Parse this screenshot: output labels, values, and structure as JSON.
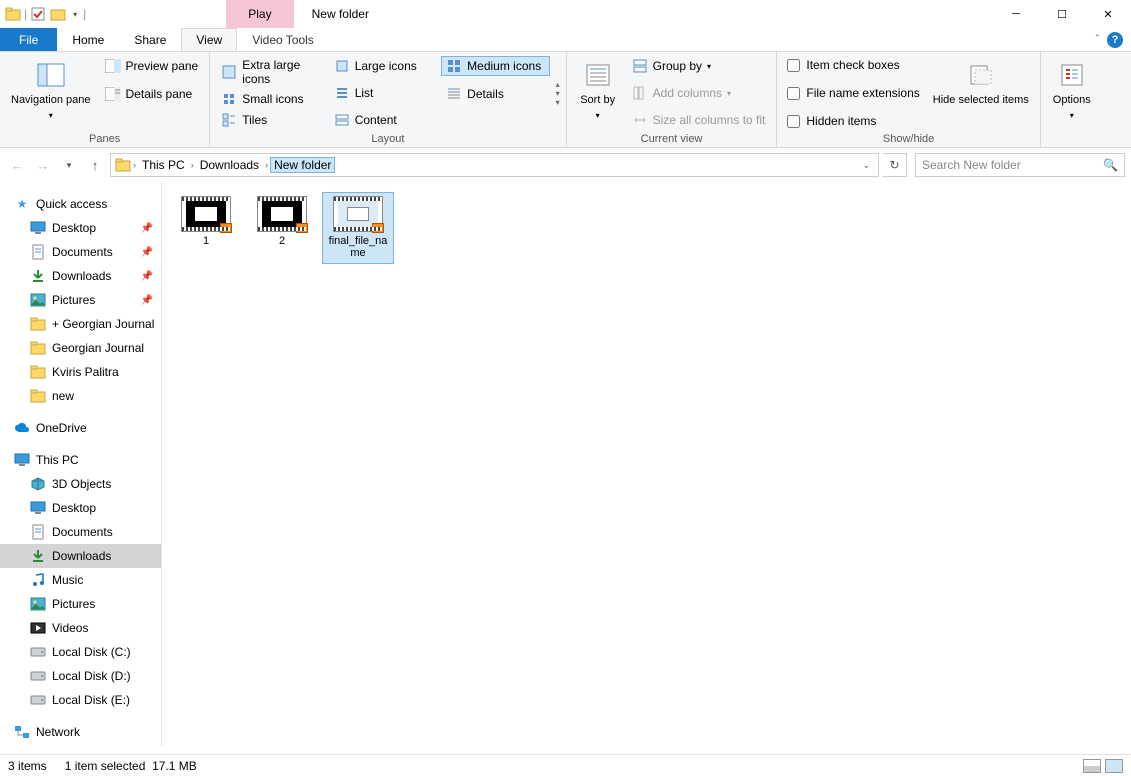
{
  "titlebar": {
    "context_tab": "Play",
    "title": "New folder"
  },
  "tabs": {
    "file": "File",
    "home": "Home",
    "share": "Share",
    "view": "View",
    "video_tools": "Video Tools"
  },
  "ribbon": {
    "panes": {
      "nav": "Navigation pane",
      "preview": "Preview pane",
      "details": "Details pane",
      "group_label": "Panes"
    },
    "layout": {
      "xl": "Extra large icons",
      "large": "Large icons",
      "medium": "Medium icons",
      "small": "Small icons",
      "list": "List",
      "details": "Details",
      "tiles": "Tiles",
      "content": "Content",
      "group_label": "Layout"
    },
    "current_view": {
      "sort": "Sort by",
      "group": "Group by",
      "add_cols": "Add columns",
      "size_cols": "Size all columns to fit",
      "group_label": "Current view"
    },
    "show_hide": {
      "item_check": "Item check boxes",
      "ext": "File name extensions",
      "hidden": "Hidden items",
      "hide_sel": "Hide selected items",
      "group_label": "Show/hide"
    },
    "options": "Options"
  },
  "breadcrumbs": [
    "This PC",
    "Downloads",
    "New folder"
  ],
  "search_placeholder": "Search New folder",
  "sidebar": {
    "quick_access": "Quick access",
    "qa_items": [
      {
        "label": "Desktop",
        "icon": "desktop",
        "pinned": true
      },
      {
        "label": "Documents",
        "icon": "documents",
        "pinned": true
      },
      {
        "label": "Downloads",
        "icon": "downloads",
        "pinned": true
      },
      {
        "label": "Pictures",
        "icon": "pictures",
        "pinned": true
      },
      {
        "label": "+ Georgian Journal",
        "icon": "folder",
        "pinned": false
      },
      {
        "label": "Georgian Journal",
        "icon": "folder",
        "pinned": false
      },
      {
        "label": "Kviris Palitra",
        "icon": "folder",
        "pinned": false
      },
      {
        "label": "new",
        "icon": "folder",
        "pinned": false
      }
    ],
    "onedrive": "OneDrive",
    "this_pc": "This PC",
    "pc_items": [
      {
        "label": "3D Objects",
        "icon": "3d"
      },
      {
        "label": "Desktop",
        "icon": "desktop"
      },
      {
        "label": "Documents",
        "icon": "documents"
      },
      {
        "label": "Downloads",
        "icon": "downloads",
        "selected": true
      },
      {
        "label": "Music",
        "icon": "music"
      },
      {
        "label": "Pictures",
        "icon": "pictures"
      },
      {
        "label": "Videos",
        "icon": "videos"
      },
      {
        "label": "Local Disk (C:)",
        "icon": "disk"
      },
      {
        "label": "Local Disk (D:)",
        "icon": "disk"
      },
      {
        "label": "Local Disk (E:)",
        "icon": "disk"
      }
    ],
    "network": "Network"
  },
  "files": [
    {
      "name": "1",
      "selected": false,
      "light": false
    },
    {
      "name": "2",
      "selected": false,
      "light": false
    },
    {
      "name": "final_file_name",
      "selected": true,
      "light": true
    }
  ],
  "status": {
    "count": "3 items",
    "selection": "1 item selected",
    "size": "17.1 MB"
  }
}
